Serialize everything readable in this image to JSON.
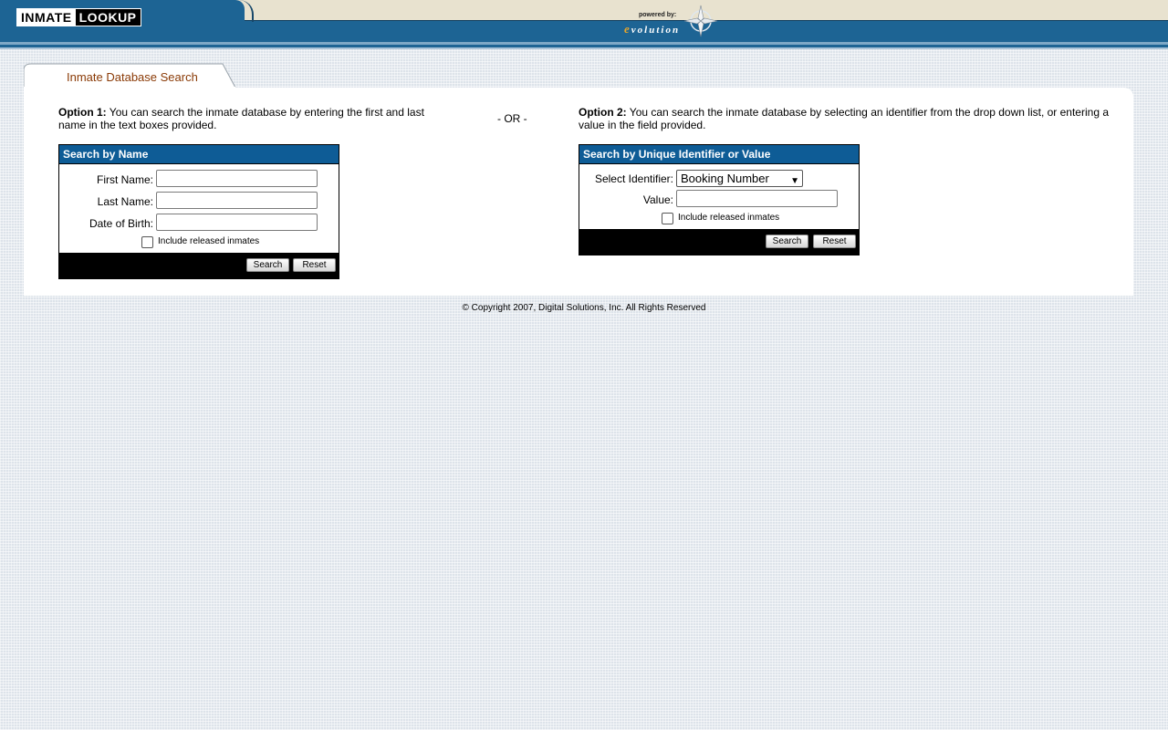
{
  "header": {
    "logo_part1": "INMATE",
    "logo_part2": "LOOKUP",
    "powered_by": "powered by:",
    "brand_e": "e",
    "brand_rest": "volution"
  },
  "tab": {
    "label": "Inmate Database Search"
  },
  "option1": {
    "heading": "Option 1:",
    "text": " You can search the inmate database by entering the first and last name in the text boxes provided."
  },
  "separator": "- OR -",
  "option2": {
    "heading": "Option 2:",
    "text": " You can search the inmate database by selecting an identifier from the drop down list, or entering a value in the field provided."
  },
  "name_search": {
    "title": "Search by Name",
    "first_name_label": "First Name:",
    "first_name_value": "",
    "last_name_label": "Last Name:",
    "last_name_value": "",
    "dob_label": "Date of Birth:",
    "dob_value": "",
    "include_released_label": "Include released inmates",
    "search_button": "Search",
    "reset_button": "Reset"
  },
  "id_search": {
    "title": "Search by Unique Identifier or Value",
    "select_label": "Select Identifier:",
    "select_value": "Booking Number",
    "value_label": "Value:",
    "value_value": "",
    "include_released_label": "Include released inmates",
    "search_button": "Search",
    "reset_button": "Reset"
  },
  "footer": {
    "copyright": "© Copyright 2007, Digital Solutions, Inc. All Rights Reserved"
  },
  "colors": {
    "header_blue": "#1d6494",
    "box_title_blue": "#0e5c96",
    "tab_text": "#8a3a06",
    "header_cream": "#e8e2cf"
  }
}
